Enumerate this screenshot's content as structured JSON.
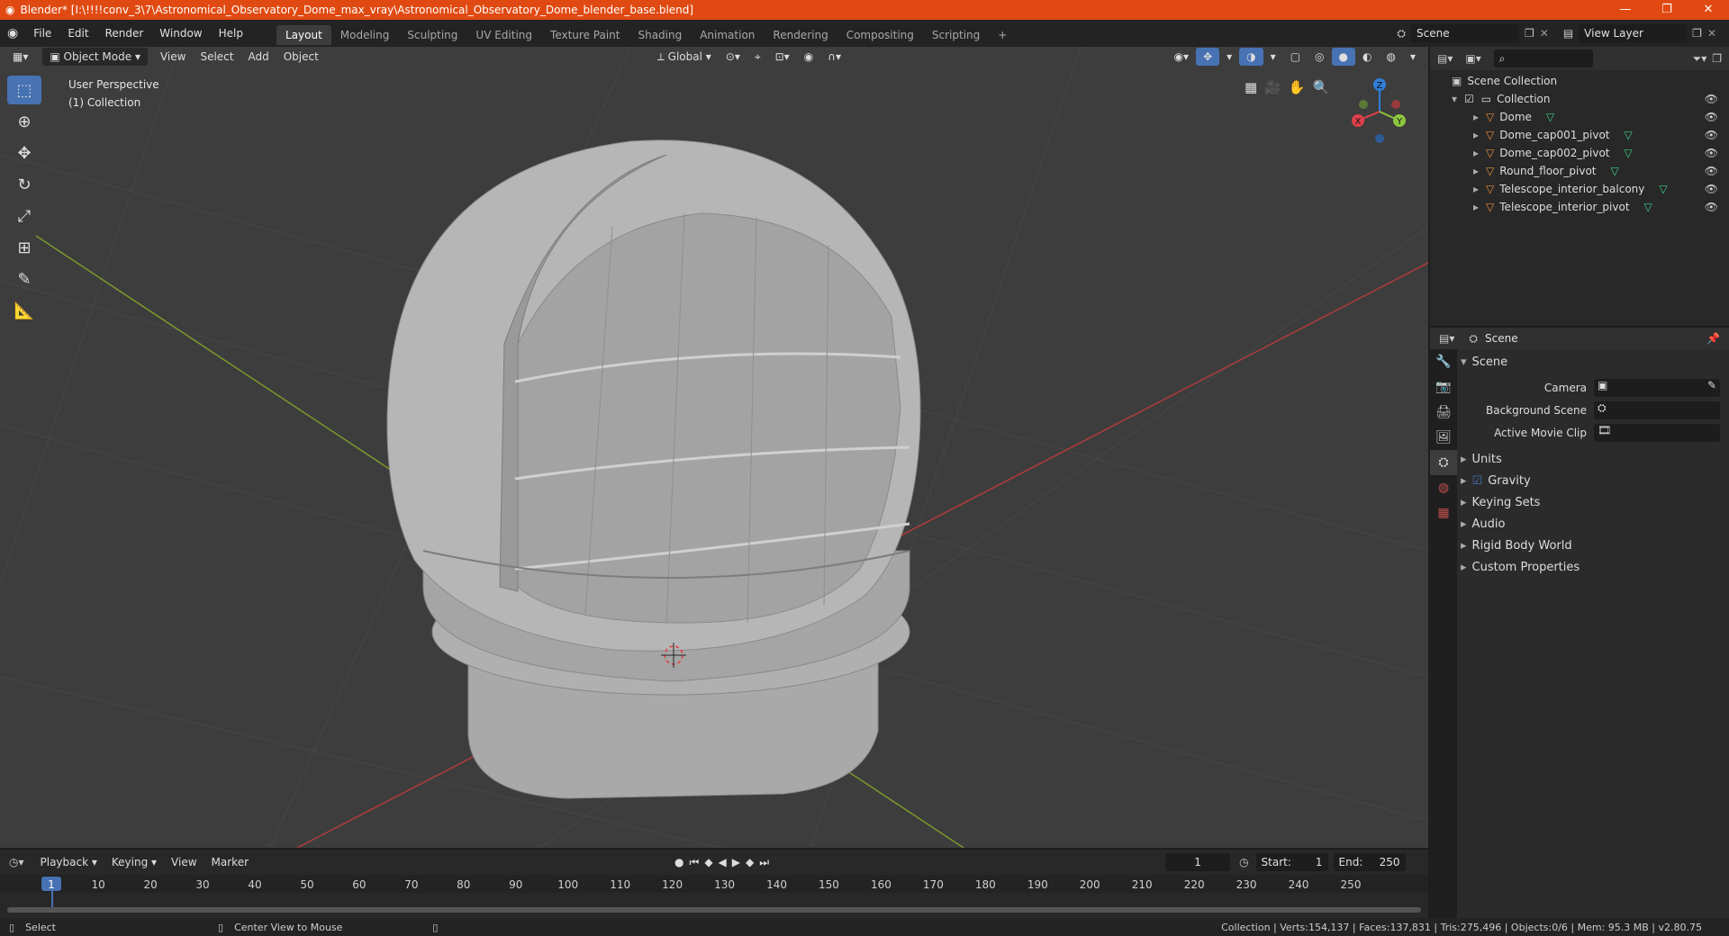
{
  "window": {
    "title": "Blender* [I:\\!!!!conv_3\\7\\Astronomical_Observatory_Dome_max_vray\\Astronomical_Observatory_Dome_blender_base.blend]",
    "minimize": "—",
    "maximize": "❐",
    "close": "✕"
  },
  "menu": [
    "File",
    "Edit",
    "Render",
    "Window",
    "Help"
  ],
  "workspaces": [
    "Layout",
    "Modeling",
    "Sculpting",
    "UV Editing",
    "Texture Paint",
    "Shading",
    "Animation",
    "Rendering",
    "Compositing",
    "Scripting"
  ],
  "workspace_add": "+",
  "scene_field": "Scene",
  "viewlayer_field": "View Layer",
  "viewport_header": {
    "mode": "Object Mode",
    "view": "View",
    "select": "Select",
    "add": "Add",
    "object": "Object",
    "orientation": "Global"
  },
  "viewport_overlay": {
    "perspective": "User Perspective",
    "collection": "(1) Collection"
  },
  "gizmo": {
    "x": "X",
    "y": "Y",
    "z": "Z"
  },
  "outliner": {
    "root": "Scene Collection",
    "collection": "Collection",
    "items": [
      "Dome",
      "Dome_cap001_pivot",
      "Dome_cap002_pivot",
      "Round_floor_pivot",
      "Telescope_interior_balcony",
      "Telescope_interior_pivot"
    ]
  },
  "properties": {
    "header": "Scene",
    "section": "Scene",
    "camera_label": "Camera",
    "background_label": "Background Scene",
    "movieclip_label": "Active Movie Clip",
    "subsections": [
      "Units",
      "Gravity",
      "Keying Sets",
      "Audio",
      "Rigid Body World",
      "Custom Properties"
    ]
  },
  "timeline": {
    "playback": "Playback",
    "keying": "Keying",
    "view": "View",
    "marker": "Marker",
    "current_frame": "1",
    "start_label": "Start:",
    "start": "1",
    "end_label": "End:",
    "end": "250",
    "ticks": [
      "1",
      "10",
      "20",
      "30",
      "40",
      "50",
      "60",
      "70",
      "80",
      "90",
      "100",
      "110",
      "120",
      "130",
      "140",
      "150",
      "160",
      "170",
      "180",
      "190",
      "200",
      "210",
      "220",
      "230",
      "240",
      "250"
    ]
  },
  "statusbar": {
    "select": "Select",
    "center_view": "Center View to Mouse",
    "stats": "Collection | Verts:154,137 | Faces:137,831 | Tris:275,496 | Objects:0/6 | Mem: 95.3 MB | v2.80.75"
  },
  "colors": {
    "titlebar": "#e04a12",
    "accent": "#4772b3",
    "viewport_bg": "#3d3d3d",
    "object_icon": "#e8913a",
    "mesh_icon": "#3bd18a"
  }
}
